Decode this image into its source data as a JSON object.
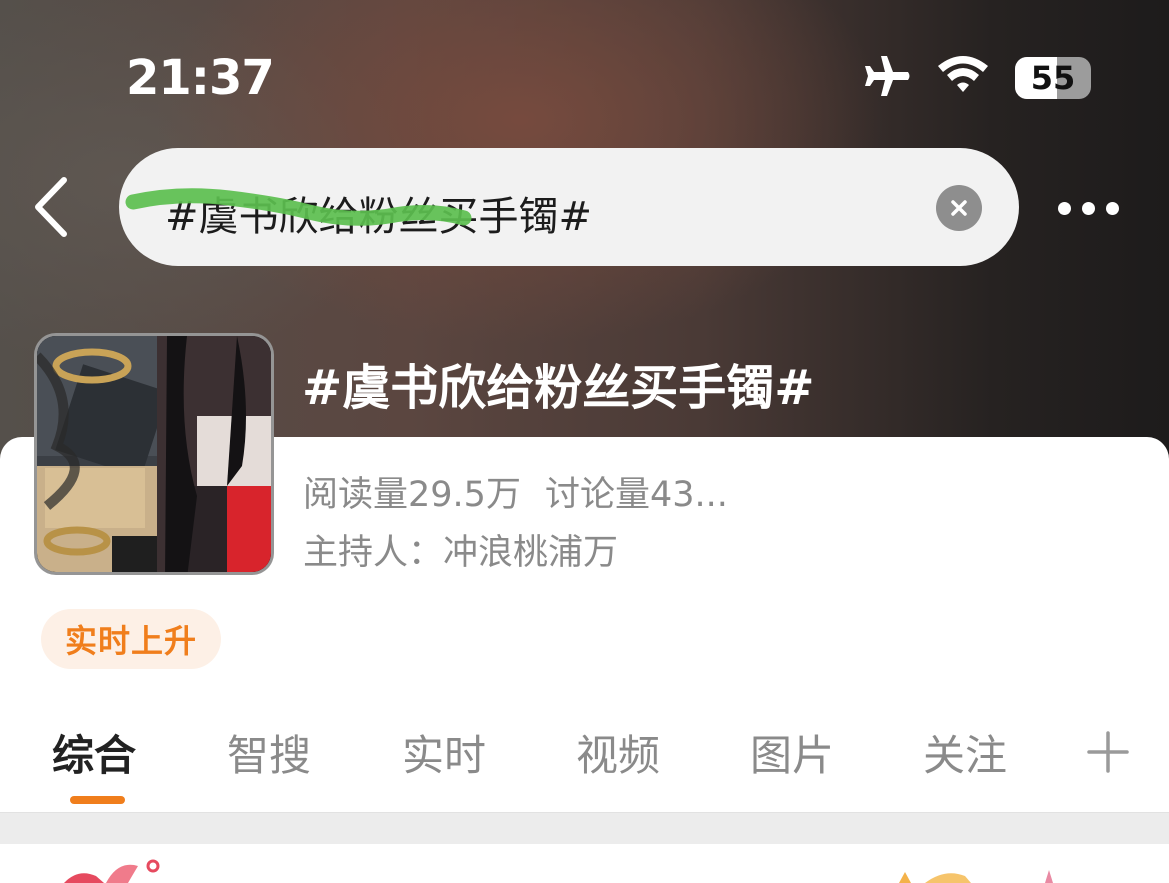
{
  "status_bar": {
    "time": "21:37",
    "battery_level": "55",
    "battery_fraction": 0.55,
    "icons": [
      "airplane-mode-icon",
      "wifi-icon",
      "battery-icon"
    ]
  },
  "search": {
    "query": "#虞书欣给粉丝买手镯#",
    "clear_icon": "close-icon",
    "back_icon": "chevron-left-icon",
    "more_icon": "more-horizontal-icon"
  },
  "topic": {
    "title": "#虞书欣给粉丝买手镯#",
    "reads_label": "阅读量",
    "reads_value": "29.5万",
    "discussions_label": "讨论量",
    "discussions_value": "43...",
    "host_label": "主持人：",
    "host_name": "冲浪桃浦万",
    "badge": "实时上升"
  },
  "tabs": [
    {
      "label": "综合",
      "active": true
    },
    {
      "label": "智搜",
      "active": false
    },
    {
      "label": "实时",
      "active": false
    },
    {
      "label": "视频",
      "active": false
    },
    {
      "label": "图片",
      "active": false
    },
    {
      "label": "关注",
      "active": false
    }
  ],
  "colors": {
    "accent": "#f07e1c",
    "badge_bg": "#fdf0e6",
    "redaction_green": "#5cbf4f",
    "muted_text": "#8a8a8a"
  }
}
